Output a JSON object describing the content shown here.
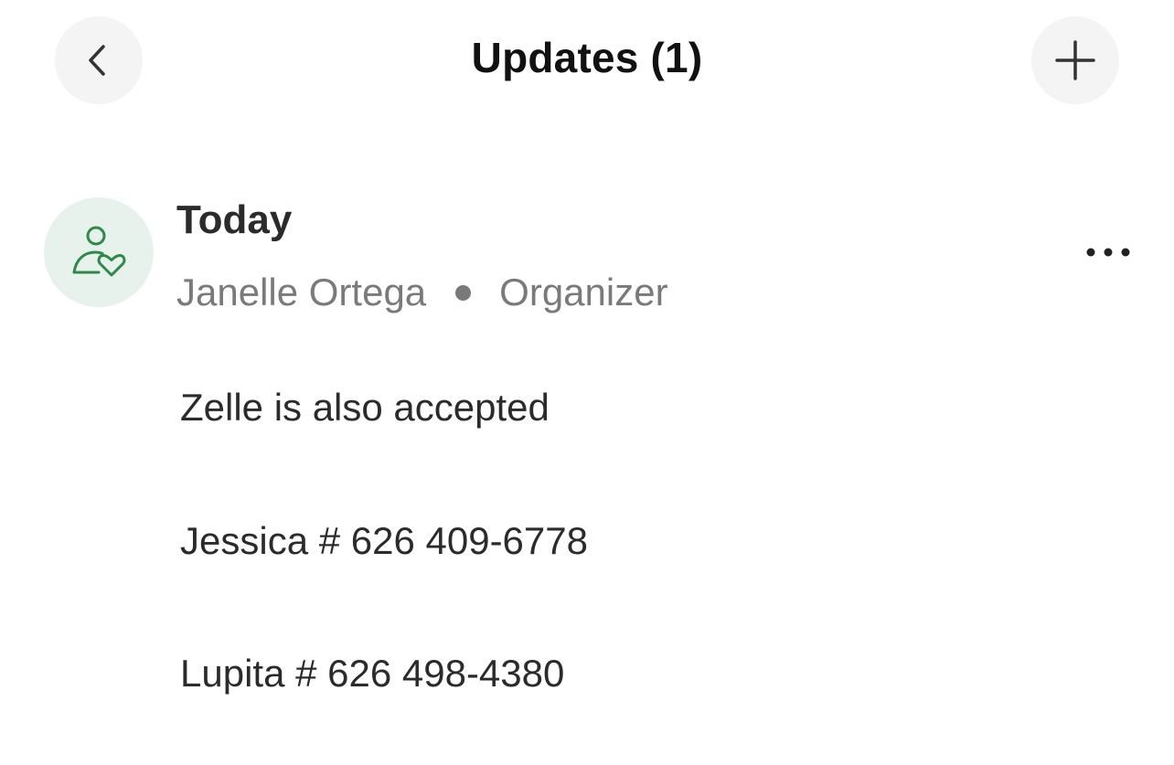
{
  "header": {
    "title": "Updates (1)",
    "back_icon": "chevron-left-icon",
    "add_icon": "plus-icon"
  },
  "update": {
    "date": "Today",
    "author": "Janelle Ortega",
    "role": "Organizer",
    "avatar_icon": "person-heart-icon",
    "menu_icon": "more-horizontal-icon",
    "body": [
      "Zelle is also accepted",
      "Jessica # 626 409-6778",
      "Lupita # 626 498-4380"
    ]
  },
  "colors": {
    "accent_green": "#2e8b47",
    "avatar_bg": "#e8f2ec",
    "button_bg": "#f4f4f4",
    "muted_text": "#7a7a7a"
  }
}
